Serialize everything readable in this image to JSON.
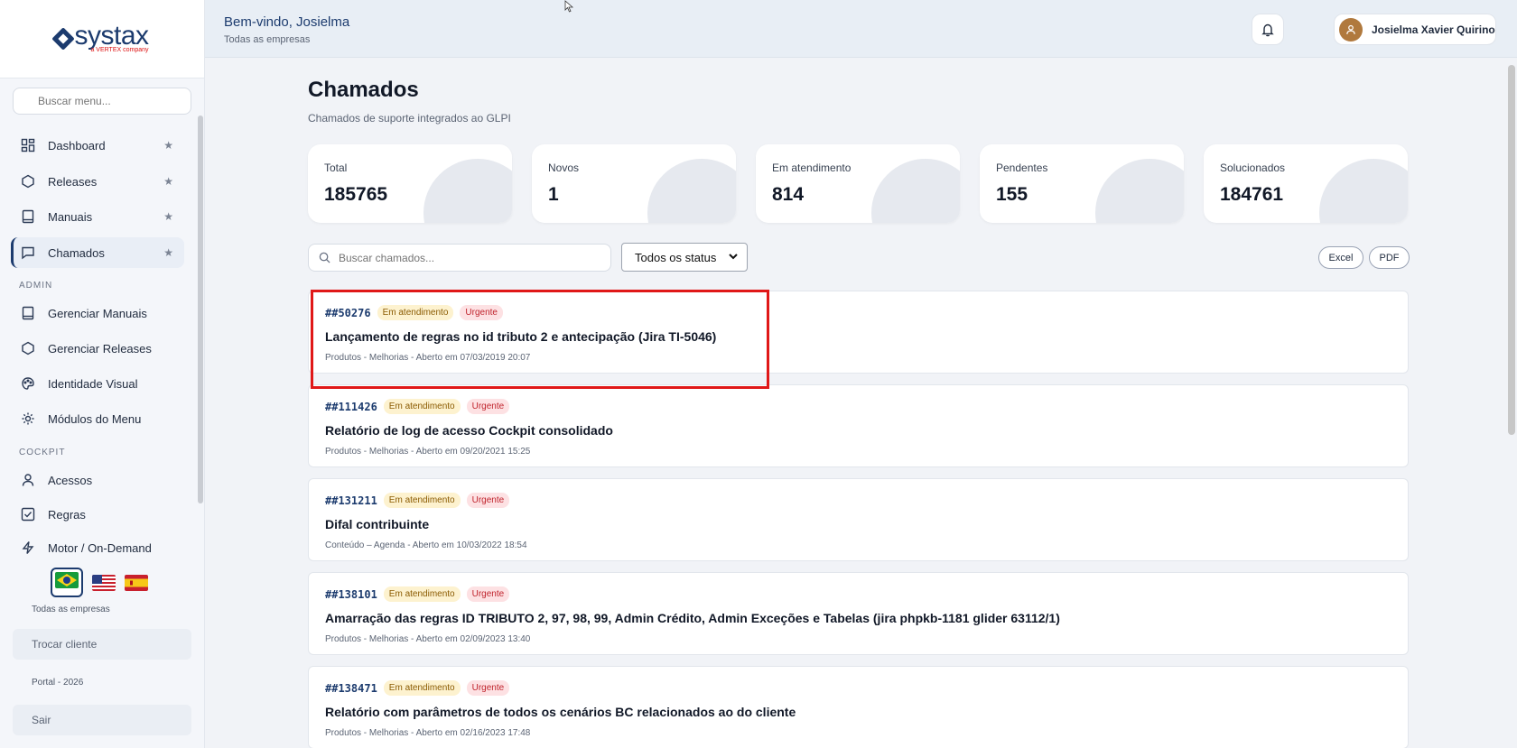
{
  "brand": {
    "name": "systax",
    "tagline": "a VERTEX company"
  },
  "sidebar": {
    "search_placeholder": "Buscar menu...",
    "items": [
      {
        "label": "Dashboard",
        "icon": "dashboard-icon",
        "starred": true
      },
      {
        "label": "Releases",
        "icon": "hexagon-icon",
        "starred": true
      },
      {
        "label": "Manuais",
        "icon": "book-icon",
        "starred": true
      },
      {
        "label": "Chamados",
        "icon": "chat-icon",
        "starred": true,
        "active": true
      }
    ],
    "admin_title": "ADMIN",
    "admin_items": [
      {
        "label": "Gerenciar Manuais",
        "icon": "book-icon"
      },
      {
        "label": "Gerenciar Releases",
        "icon": "hexagon-icon"
      },
      {
        "label": "Identidade Visual",
        "icon": "palette-icon"
      },
      {
        "label": "Módulos do Menu",
        "icon": "gear-icon"
      }
    ],
    "cockpit_title": "COCKPIT",
    "cockpit_items": [
      {
        "label": "Acessos",
        "icon": "user-icon"
      },
      {
        "label": "Regras",
        "icon": "checkbox-icon"
      },
      {
        "label": "Motor / On-Demand",
        "icon": "bolt-icon"
      }
    ],
    "languages": [
      "pt-BR",
      "en-US",
      "es-ES"
    ],
    "company_scope": "Todas as empresas",
    "switch_client_label": "Trocar cliente",
    "footer": "Portal - 2026",
    "logout_label": "Sair"
  },
  "header": {
    "welcome": "Bem-vindo, Josielma",
    "scope": "Todas as empresas",
    "user_name": "Josielma Xavier Quirino"
  },
  "page": {
    "title": "Chamados",
    "subtitle": "Chamados de suporte integrados ao GLPI"
  },
  "stats": [
    {
      "label": "Total",
      "value": "185765"
    },
    {
      "label": "Novos",
      "value": "1"
    },
    {
      "label": "Em atendimento",
      "value": "814"
    },
    {
      "label": "Pendentes",
      "value": "155"
    },
    {
      "label": "Solucionados",
      "value": "184761"
    }
  ],
  "filters": {
    "search_placeholder": "Buscar chamados...",
    "status_selected": "Todos os status",
    "excel_label": "Excel",
    "pdf_label": "PDF"
  },
  "tickets": [
    {
      "id": "##50276",
      "status": "Em atendimento",
      "priority": "Urgente",
      "title": "Lançamento de regras no id tributo 2 e antecipação (Jira TI-5046)",
      "meta": "Produtos - Melhorias - Aberto em 07/03/2019 20:07"
    },
    {
      "id": "##111426",
      "status": "Em atendimento",
      "priority": "Urgente",
      "title": "Relatório de log de acesso Cockpit consolidado",
      "meta": "Produtos - Melhorias - Aberto em 09/20/2021 15:25"
    },
    {
      "id": "##131211",
      "status": "Em atendimento",
      "priority": "Urgente",
      "title": "Difal contribuinte",
      "meta": "Conteúdo – Agenda - Aberto em 10/03/2022 18:54"
    },
    {
      "id": "##138101",
      "status": "Em atendimento",
      "priority": "Urgente",
      "title": "Amarração das regras ID TRIBUTO 2, 97, 98, 99, Admin Crédito, Admin Exceções e Tabelas (jira phpkb-1181 glider 63112/1)",
      "meta": "Produtos - Melhorias - Aberto em 02/09/2023 13:40"
    },
    {
      "id": "##138471",
      "status": "Em atendimento",
      "priority": "Urgente",
      "title": "Relatório com parâmetros de todos os cenários BC relacionados ao do cliente",
      "meta": "Produtos - Melhorias - Aberto em 02/16/2023 17:48"
    }
  ],
  "colors": {
    "brand": "#1c3b6e",
    "highlight": "#e01818",
    "warning_badge": "#fdf2cf",
    "urgent_badge": "#fde1e3"
  }
}
